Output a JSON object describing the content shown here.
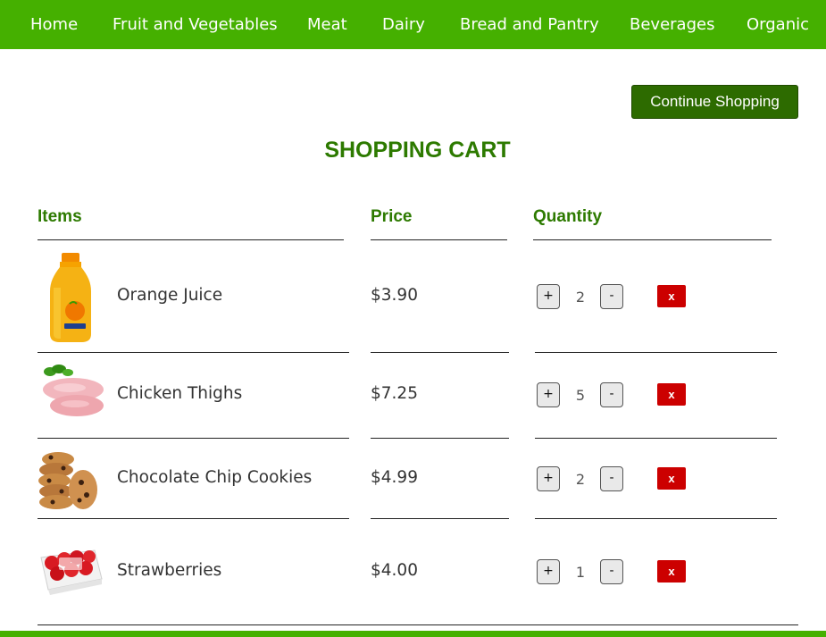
{
  "nav": {
    "items": [
      {
        "label": "Home"
      },
      {
        "label": "Fruit and Vegetables"
      },
      {
        "label": "Meat"
      },
      {
        "label": "Dairy"
      },
      {
        "label": "Bread and Pantry"
      },
      {
        "label": "Beverages"
      },
      {
        "label": "Organic"
      }
    ]
  },
  "header": {
    "continue_label": "Continue Shopping",
    "title": "SHOPPING CART"
  },
  "table": {
    "columns": {
      "items": "Items",
      "price": "Price",
      "quantity": "Quantity"
    }
  },
  "controls": {
    "plus": "+",
    "minus": "-",
    "remove": "x"
  },
  "cart": [
    {
      "name": "Orange Juice",
      "price": "$3.90",
      "qty": "2",
      "image": "orange-juice-bottle"
    },
    {
      "name": "Chicken Thighs",
      "price": "$7.25",
      "qty": "5",
      "image": "raw-chicken"
    },
    {
      "name": "Chocolate Chip Cookies",
      "price": "$4.99",
      "qty": "2",
      "image": "cookie-stack"
    },
    {
      "name": "Strawberries",
      "price": "$4.00",
      "qty": "1",
      "image": "strawberry-punnet"
    }
  ],
  "colors": {
    "brand_green": "#45b000",
    "heading_green": "#2d7a00",
    "button_green": "#2d6b00",
    "remove_red": "#cc0000"
  }
}
